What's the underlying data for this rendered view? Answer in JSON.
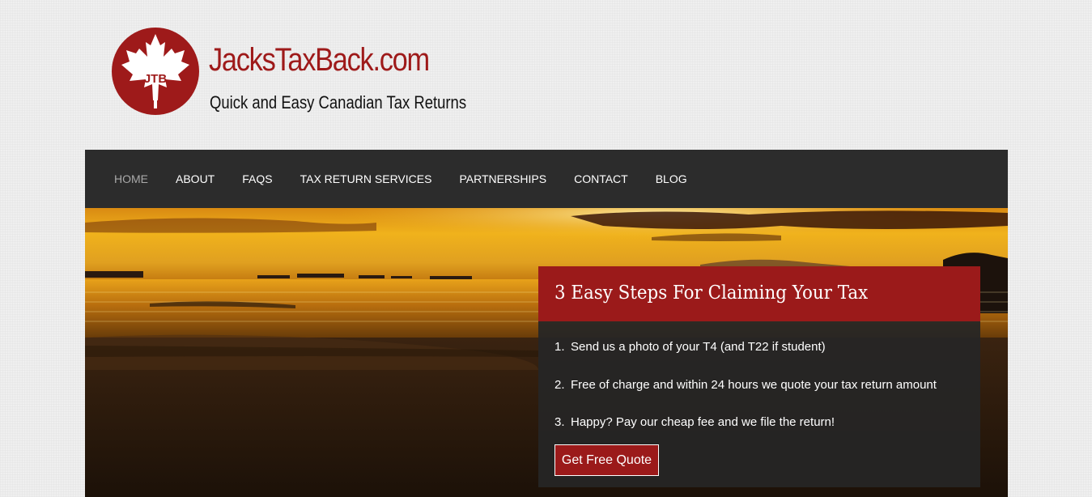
{
  "brand": {
    "logo_initials": "JTB",
    "name": "JacksTaxBack.com",
    "tagline": "Quick and Easy Canadian Tax Returns",
    "color": "#9e1a1a"
  },
  "nav": {
    "items": [
      {
        "label": "HOME",
        "active": true
      },
      {
        "label": "ABOUT",
        "active": false
      },
      {
        "label": "FAQS",
        "active": false
      },
      {
        "label": "TAX RETURN SERVICES",
        "active": false
      },
      {
        "label": "PARTNERSHIPS",
        "active": false
      },
      {
        "label": "CONTACT",
        "active": false
      },
      {
        "label": "BLOG",
        "active": false
      }
    ],
    "background": "#2c2c2c"
  },
  "hero": {
    "image": "sunset-beach-photo"
  },
  "steps": {
    "heading": "3 Easy Steps For Claiming Your Tax",
    "items": [
      {
        "num": "1.",
        "text": "Send us a photo of your T4 (and T22 if student)"
      },
      {
        "num": "2.",
        "text": "Free of charge and within 24 hours we quote your tax return amount"
      },
      {
        "num": "3.",
        "text": "Happy? Pay our cheap fee and we file the return!"
      }
    ],
    "button_label": "Get Free Quote",
    "accent": "#9b1a1a"
  }
}
